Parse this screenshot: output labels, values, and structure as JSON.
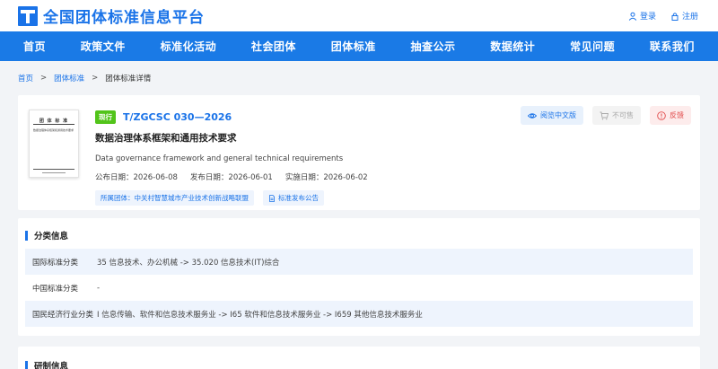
{
  "header": {
    "site_title": "全国团体标准信息平台",
    "login": "登录",
    "register": "注册"
  },
  "nav": {
    "items": [
      "首页",
      "政策文件",
      "标准化活动",
      "社会团体",
      "团体标准",
      "抽查公示",
      "数据统计",
      "常见问题",
      "联系我们"
    ]
  },
  "breadcrumb": {
    "home": "首页",
    "standards": "团体标准",
    "current": "团体标准详情",
    "sep": ">"
  },
  "cover": {
    "title": "团 体 标 准",
    "text": "数据治理体系框架和通用技术要求"
  },
  "standard": {
    "status": "现行",
    "code": "T/ZGCSC 030—2026",
    "title_cn": "数据治理体系框架和通用技术要求",
    "title_en": "Data governance framework and general technical requirements",
    "dates": [
      "公布日期：2026-06-08",
      "发布日期：2026-06-01",
      "实施日期：2026-06-02"
    ],
    "org_tag": "所属团体：中关村智慧城市产业技术创新战略联盟",
    "notice_tag": "标准发布公告"
  },
  "actions": {
    "preview": "阅览中文版",
    "unavailable": "不可售",
    "feedback": "反馈"
  },
  "classification": {
    "title": "分类信息",
    "rows": [
      {
        "label": "国际标准分类",
        "value": "35 信息技术、办公机械 -> 35.020 信息技术(IT)综合"
      },
      {
        "label": "中国标准分类",
        "value": "-"
      },
      {
        "label": "国民经济行业分类",
        "value": "I 信息传输、软件和信息技术服务业 -> I65 软件和信息技术服务业 -> I659 其他信息技术服务业"
      }
    ]
  },
  "drafting": {
    "title": "研制信息"
  },
  "colors": {
    "brand": "#1a73e8",
    "nav_bg": "#1a7ae6",
    "status_green": "#52c41a",
    "feedback_red": "#e14a4a"
  }
}
